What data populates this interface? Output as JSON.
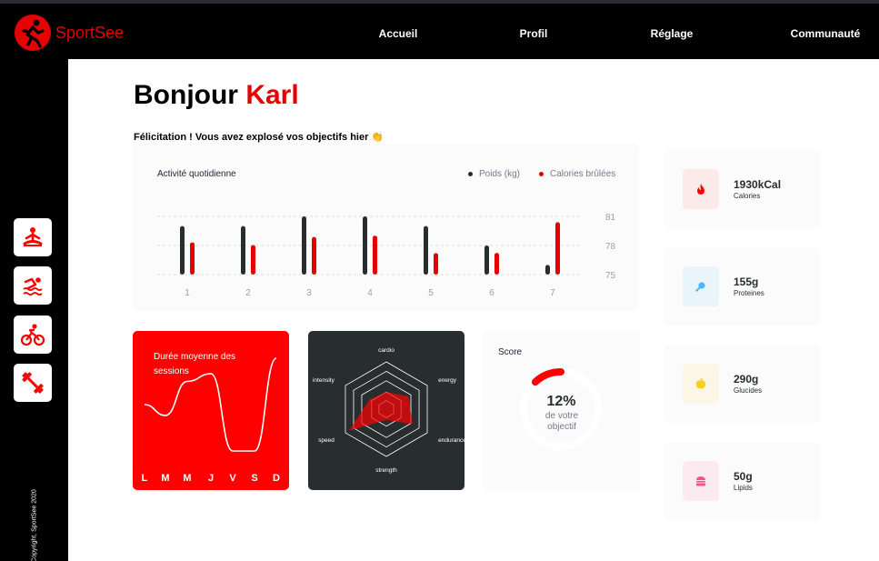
{
  "app": {
    "name": "SportSee"
  },
  "nav": {
    "items": [
      "Accueil",
      "Profil",
      "Réglage",
      "Communauté"
    ]
  },
  "sidebar": {
    "icons": [
      "yoga-icon",
      "swimming-icon",
      "cycling-icon",
      "dumbbell-icon"
    ],
    "copyright": "Copyright, SportSee 2020"
  },
  "header": {
    "greeting": "Bonjour",
    "name": "Karl",
    "message": "Félicitation ! Vous avez explosé vos objectifs hier 👏"
  },
  "colors": {
    "accent": "#e60000",
    "weight": "#282d30",
    "calories": "#e60000"
  },
  "activity": {
    "title": "Activité quotidienne",
    "legend_weight": "Poids (kg)",
    "legend_calories": "Calories brûlées"
  },
  "sessions": {
    "title": "Durée moyenne des sessions",
    "days": [
      "L",
      "M",
      "M",
      "J",
      "V",
      "S",
      "D"
    ]
  },
  "performance": {
    "axes": [
      "cardio",
      "energy",
      "endurance",
      "strength",
      "speed",
      "intensity"
    ]
  },
  "score": {
    "title": "Score",
    "value": "12%",
    "label": "de votre objectif",
    "fraction": 0.12
  },
  "key_data": [
    {
      "value": "1930kCal",
      "label": "Calories",
      "icon": "fire-icon",
      "bg": "#fbeaea",
      "color": "#ff0000"
    },
    {
      "value": "155g",
      "label": "Proteines",
      "icon": "chicken-icon",
      "bg": "#e9f4fb",
      "color": "#4ab8ff"
    },
    {
      "value": "290g",
      "label": "Glucides",
      "icon": "apple-icon",
      "bg": "#fbf6e5",
      "color": "#f9ce23"
    },
    {
      "value": "50g",
      "label": "Lipids",
      "icon": "burger-icon",
      "bg": "#fbeaef",
      "color": "#fd5181"
    }
  ],
  "chart_data": [
    {
      "type": "bar",
      "title": "Activité quotidienne",
      "categories": [
        "1",
        "2",
        "3",
        "4",
        "5",
        "6",
        "7"
      ],
      "series": [
        {
          "name": "Poids (kg)",
          "values": [
            80,
            80,
            81,
            81,
            80,
            78,
            76
          ]
        },
        {
          "name": "Calories brûlées",
          "values": [
            240,
            220,
            280,
            290,
            160,
            162,
            390
          ]
        }
      ],
      "y_ticks": [
        "75",
        "78",
        "81"
      ],
      "ylim": [
        75,
        81
      ]
    },
    {
      "type": "line",
      "title": "Durée moyenne des sessions",
      "categories": [
        "L",
        "M",
        "M",
        "J",
        "V",
        "S",
        "D"
      ],
      "values": [
        30,
        23,
        45,
        50,
        0,
        0,
        60
      ]
    },
    {
      "type": "radar",
      "categories": [
        "cardio",
        "energy",
        "endurance",
        "strength",
        "speed",
        "intensity"
      ],
      "values": [
        80,
        120,
        140,
        50,
        200,
        90
      ]
    }
  ]
}
